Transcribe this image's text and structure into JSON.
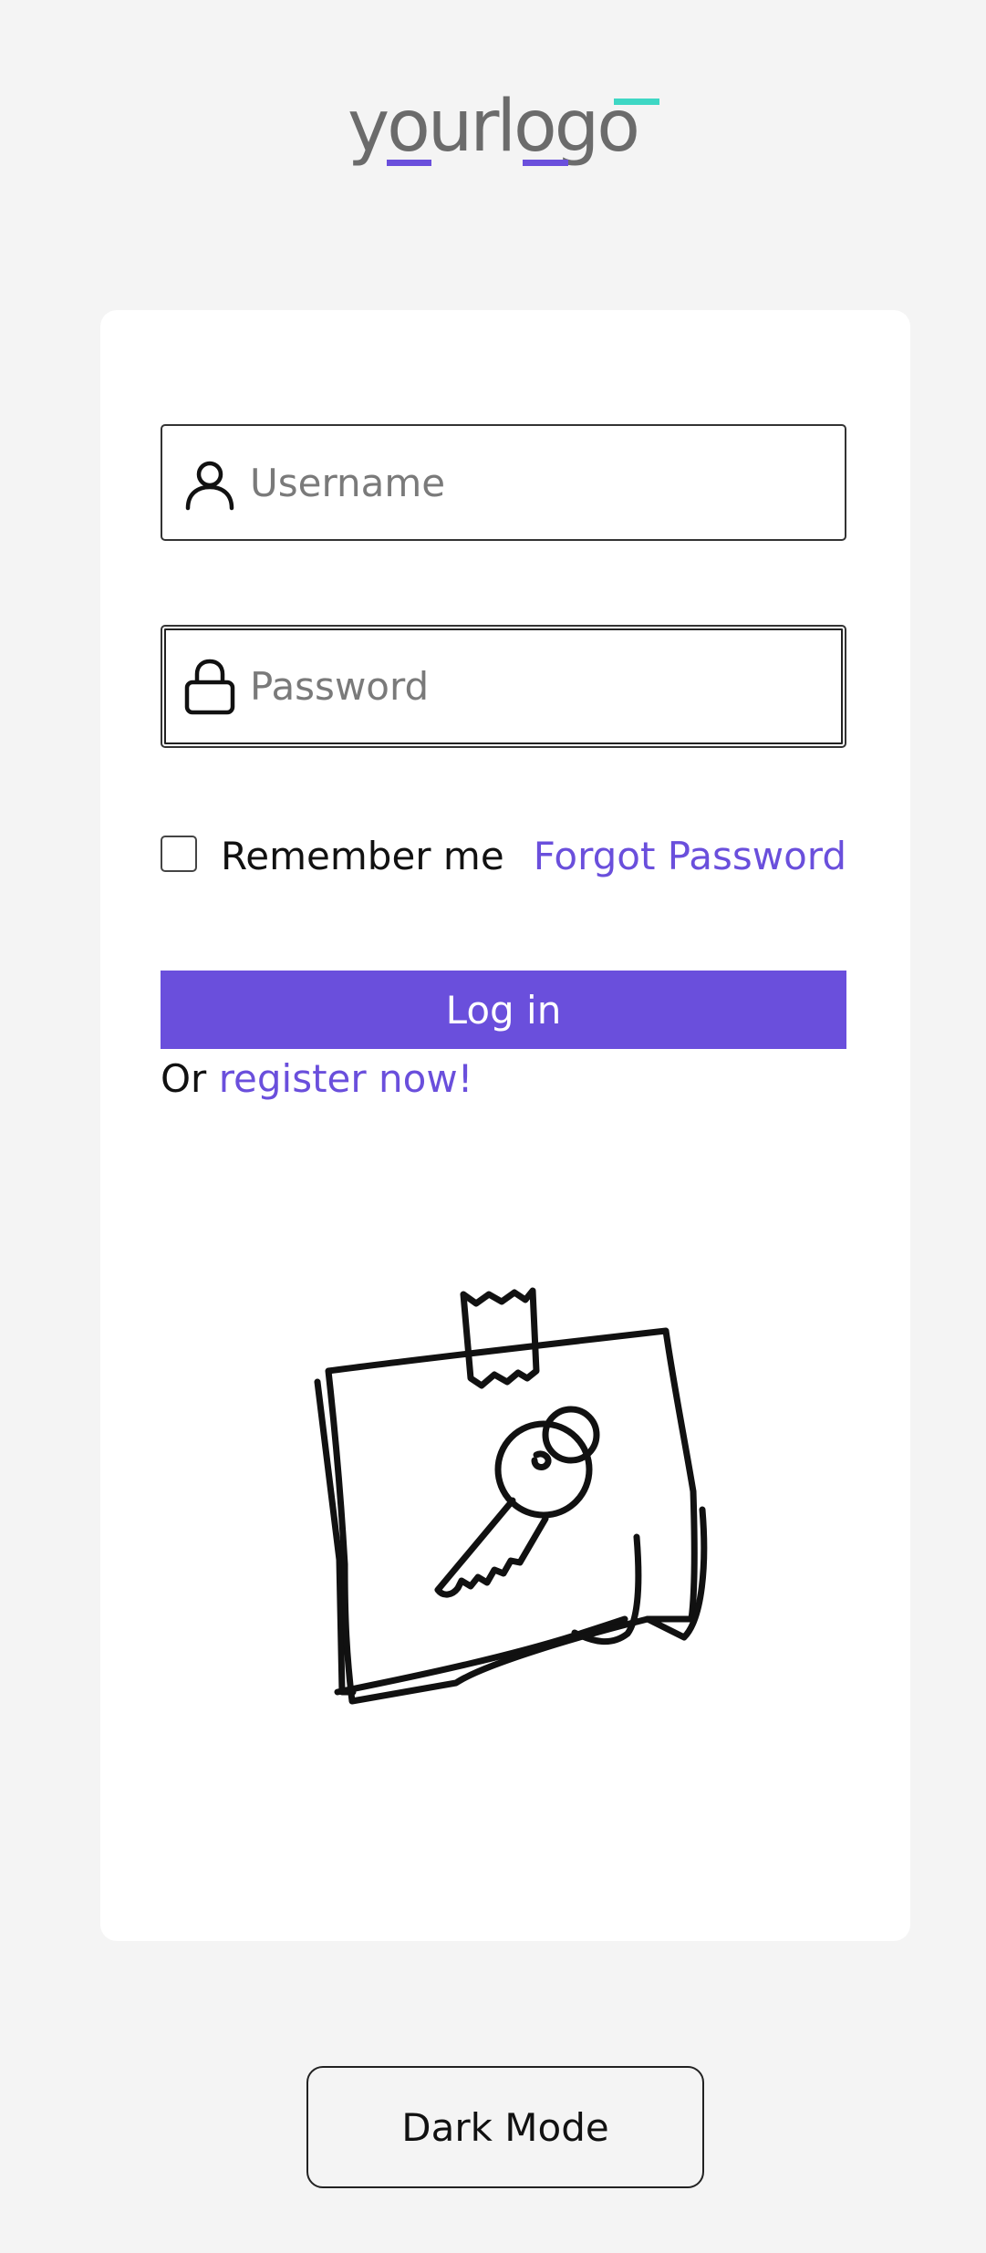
{
  "logo": {
    "text": "yourlogo",
    "text_color": "#6b6b6b",
    "accent_purple": "#6a4fdc",
    "accent_teal": "#3ed7c4"
  },
  "form": {
    "username_placeholder": "Username",
    "username_value": "",
    "password_placeholder": "Password",
    "password_value": "",
    "remember_label": "Remember me",
    "remember_checked": false,
    "forgot_label": "Forgot Password",
    "login_label": "Log in",
    "register_prefix": "Or ",
    "register_link": "register now!"
  },
  "icons": {
    "username": "user-icon",
    "password": "lock-icon",
    "illustration": "sticky-note-key-icon"
  },
  "footer": {
    "dark_mode_label": "Dark Mode"
  },
  "colors": {
    "background": "#f4f4f4",
    "card": "#ffffff",
    "primary": "#6a4fdc",
    "text": "#111111",
    "placeholder": "#7a7a7a"
  }
}
